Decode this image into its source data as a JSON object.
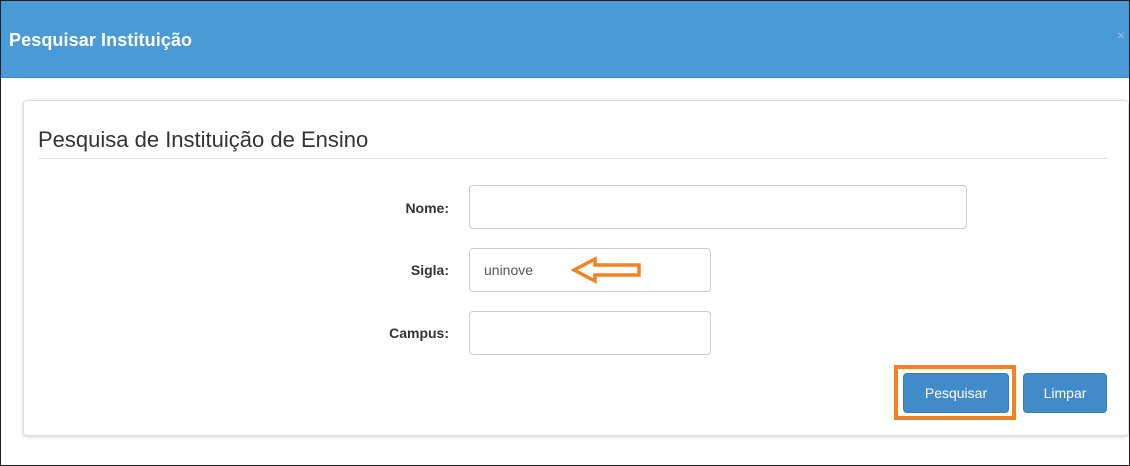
{
  "modal": {
    "title": "Pesquisar Instituição",
    "close_label": "×"
  },
  "panel": {
    "title": "Pesquisa de Instituição de Ensino"
  },
  "form": {
    "nome_label": "Nome:",
    "nome_value": "",
    "sigla_label": "Sigla:",
    "sigla_value": "uninove",
    "campus_label": "Campus:",
    "campus_value": ""
  },
  "buttons": {
    "pesquisar_label": "Pesquisar",
    "limpar_label": "Limpar"
  },
  "colors": {
    "header": "#4a9ad8",
    "button": "#428bca",
    "annotation": "#f58220"
  }
}
